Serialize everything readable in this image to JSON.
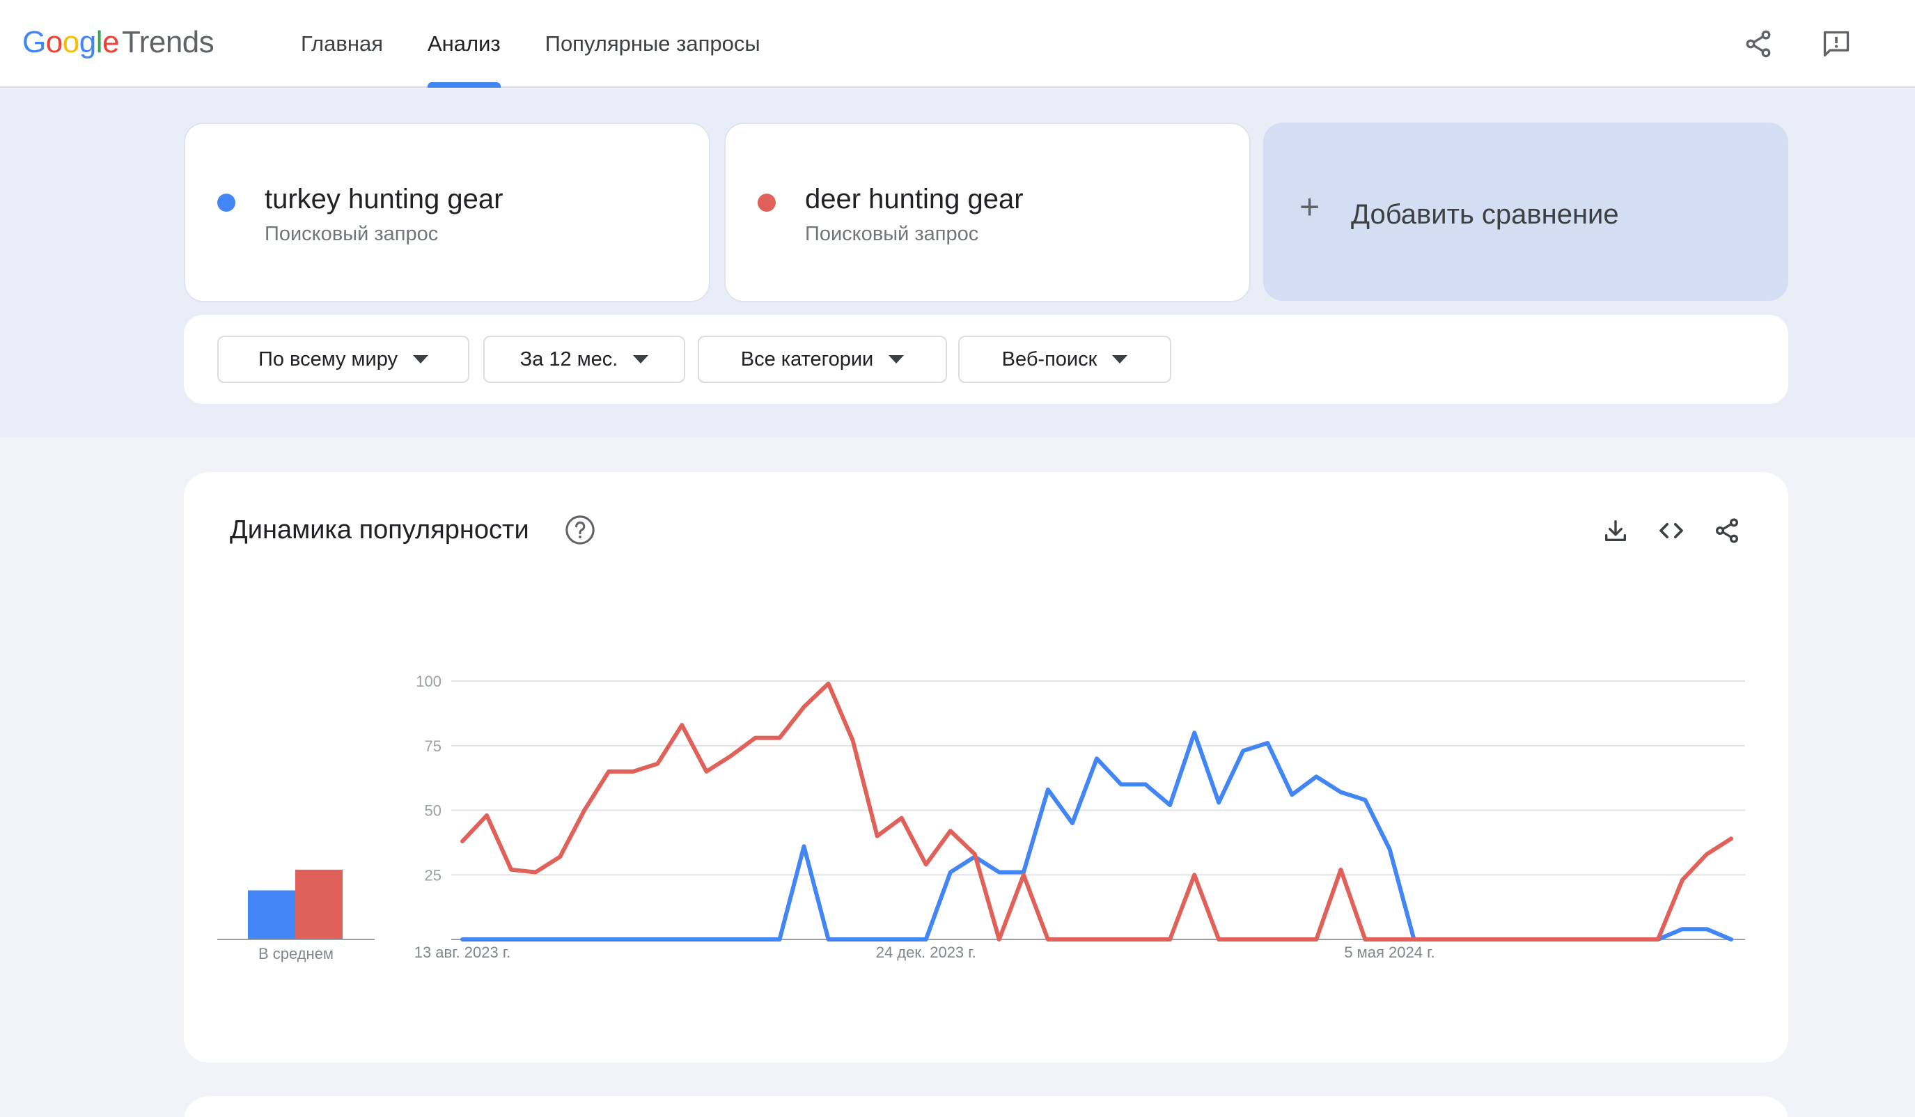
{
  "app": {
    "logo_parts": [
      "G",
      "o",
      "o",
      "g",
      "l",
      "e"
    ],
    "logo_trends": "Trends"
  },
  "nav": {
    "items": [
      {
        "label": "Главная"
      },
      {
        "label": "Анализ"
      },
      {
        "label": "Популярные запросы"
      }
    ],
    "active": "Анализ"
  },
  "terms": [
    {
      "title": "turkey hunting gear",
      "subtitle": "Поисковый запрос",
      "color": "#4285f4"
    },
    {
      "title": "deer hunting gear",
      "subtitle": "Поисковый запрос",
      "color": "#e0615a"
    }
  ],
  "add_compare": {
    "plus": "+",
    "label": "Добавить сравнение"
  },
  "filters": [
    {
      "label": "По всему миру"
    },
    {
      "label": "За 12 мес."
    },
    {
      "label": "Все категории"
    },
    {
      "label": "Веб-поиск"
    }
  ],
  "card": {
    "title": "Динамика популярности"
  },
  "icons": {
    "header_share": "share-icon",
    "header_feedback": "feedback-icon",
    "help": "help-circle-icon",
    "download": "download-icon",
    "embed": "code-embed-icon",
    "card_share": "share-icon"
  },
  "chart_data": {
    "type": "line",
    "ylim": [
      0,
      100
    ],
    "yticks": [
      "100",
      "75",
      "50",
      "25"
    ],
    "xticks": [
      {
        "index": 0,
        "label": "13 авг. 2023 г."
      },
      {
        "index": 19,
        "label": "24 дек. 2023 г."
      },
      {
        "index": 38,
        "label": "5 мая 2024 г."
      }
    ],
    "average_label": "В среднем",
    "averages": [
      19,
      27
    ],
    "series": [
      {
        "color": "#4285f4",
        "values": [
          0,
          0,
          0,
          0,
          0,
          0,
          0,
          0,
          0,
          0,
          0,
          0,
          0,
          0,
          36,
          0,
          0,
          0,
          0,
          0,
          26,
          32,
          26,
          26,
          58,
          45,
          70,
          60,
          60,
          52,
          80,
          53,
          73,
          76,
          56,
          63,
          57,
          54,
          35,
          0,
          0,
          0,
          0,
          0,
          0,
          0,
          0,
          0,
          0,
          0,
          4,
          4,
          0
        ]
      },
      {
        "color": "#e0615a",
        "values": [
          38,
          48,
          27,
          26,
          32,
          50,
          65,
          65,
          68,
          83,
          65,
          71,
          78,
          78,
          90,
          99,
          77,
          40,
          47,
          29,
          42,
          33,
          0,
          25,
          0,
          0,
          0,
          0,
          0,
          0,
          25,
          0,
          0,
          0,
          0,
          0,
          27,
          0,
          0,
          0,
          0,
          0,
          0,
          0,
          0,
          0,
          0,
          0,
          0,
          0,
          23,
          33,
          39
        ]
      }
    ]
  }
}
